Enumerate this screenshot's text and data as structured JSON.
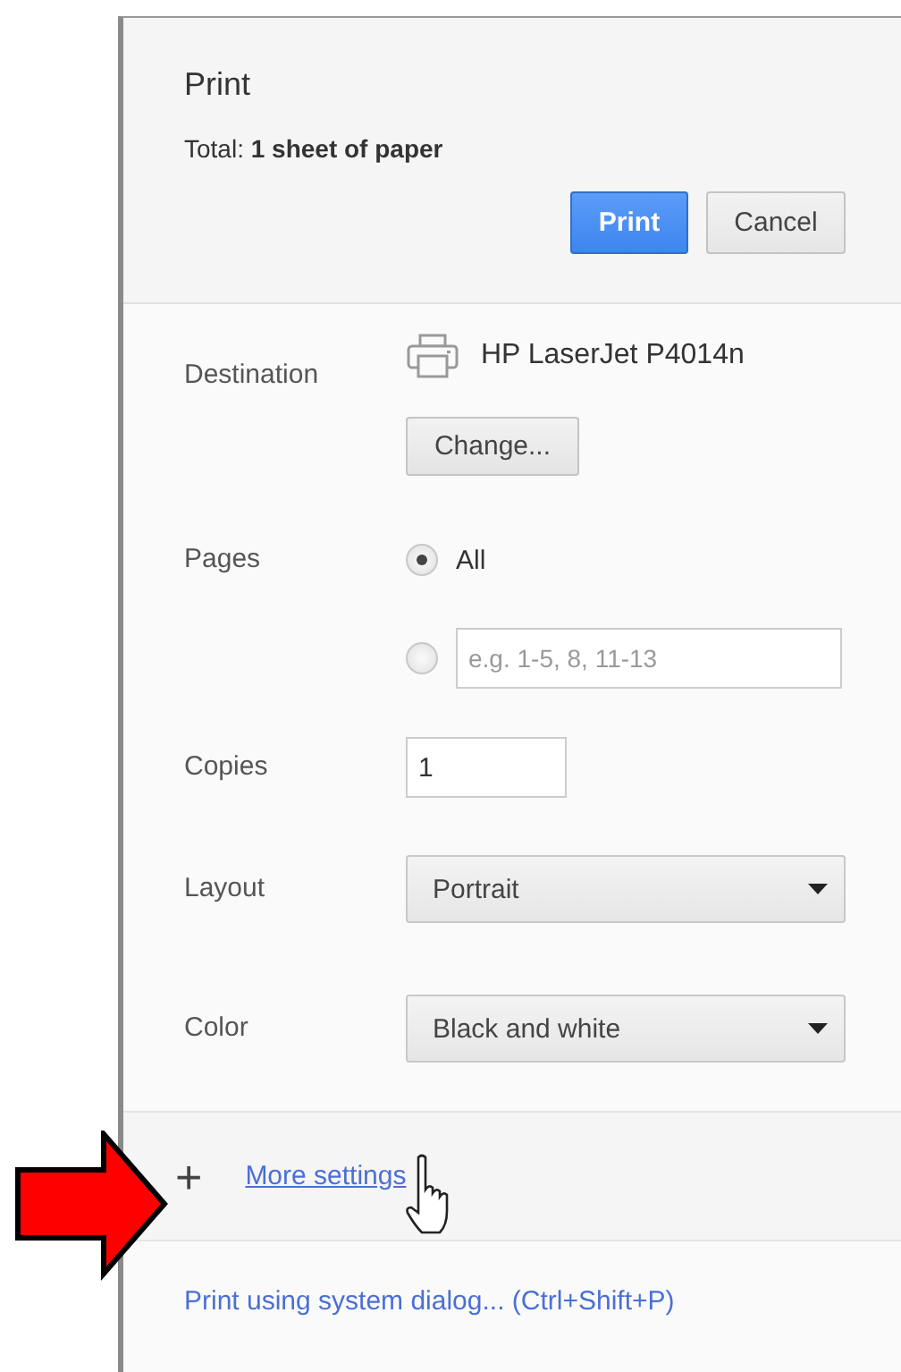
{
  "dialog": {
    "title": "Print",
    "total": "Total: **1 sheet of paper**",
    "buttons": [
      {
        "label": "Print",
        "kind": "primary"
      },
      {
        "label": "Cancel",
        "kind": "secondary"
      }
    ]
  },
  "destination": {
    "label": "Destination",
    "printer": "HP LaserJet P4014n",
    "change_button": "Change..."
  },
  "pages": {
    "label": "Pages",
    "options": [
      {
        "kind": "all",
        "label": "All",
        "selected": true
      },
      {
        "kind": "range",
        "placeholder": "e.g. 1-5, 8, 11-13",
        "selected": false
      }
    ]
  },
  "copies": {
    "label": "Copies",
    "value": "1"
  },
  "layout": {
    "label": "Layout",
    "value": "Portrait"
  },
  "color": {
    "label": "Color",
    "value": "Black and white"
  },
  "more_settings": {
    "icon": "+",
    "link": "More settings"
  },
  "system_dialog_link": "Print using system dialog... (Ctrl+Shift+P)"
}
